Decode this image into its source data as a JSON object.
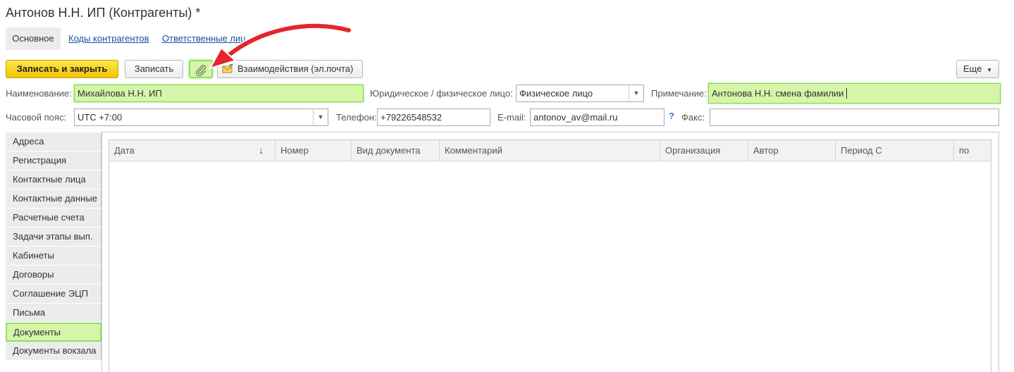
{
  "window": {
    "title": "Антонов Н.Н. ИП (Контрагенты) *"
  },
  "nav": {
    "main": "Основное",
    "codes": "Коды контрагентов",
    "responsible": "Ответственные лица"
  },
  "toolbar": {
    "save_close": "Записать и закрыть",
    "save": "Записать",
    "interactions": "Взаимодействия (эл.почта)",
    "more": "Еще"
  },
  "form": {
    "name_label": "Наименование:",
    "name_value": "Михайлова Н.Н. ИП",
    "legal_label": "Юридическое / физическое лицо:",
    "legal_value": "Физическое лицо",
    "note_label": "Примечание:",
    "note_value": "Антонова Н.Н. смена фамилии",
    "tz_label": "Часовой пояс:",
    "tz_value": "UTC +7:00",
    "phone_label": "Телефон:",
    "phone_value": "+79226548532",
    "email_label": "E-mail:",
    "email_value": "antonov_av@mail.ru",
    "help_mark": "?",
    "fax_label": "Факс:",
    "fax_value": ""
  },
  "tabs": [
    {
      "label": "Адреса"
    },
    {
      "label": "Регистрация"
    },
    {
      "label": "Контактные лица"
    },
    {
      "label": "Контактные данные"
    },
    {
      "label": "Расчетные счета"
    },
    {
      "label": "Задачи этапы вып."
    },
    {
      "label": "Кабинеты"
    },
    {
      "label": "Договоры"
    },
    {
      "label": "Соглашение ЭЦП"
    },
    {
      "label": "Письма"
    },
    {
      "label": "Документы",
      "active": true
    },
    {
      "label": "Документы вокзала"
    }
  ],
  "table": {
    "columns": [
      "Дата",
      "Номер",
      "Вид документа",
      "Комментарий",
      "Организация",
      "Автор",
      "Период С",
      "по"
    ],
    "sort_indicator": "↓"
  },
  "colors": {
    "highlight": "#d5f5a8",
    "highlight_border": "#8fe262",
    "primary_button": "#f2c200",
    "annotation_arrow": "#e3262b"
  }
}
